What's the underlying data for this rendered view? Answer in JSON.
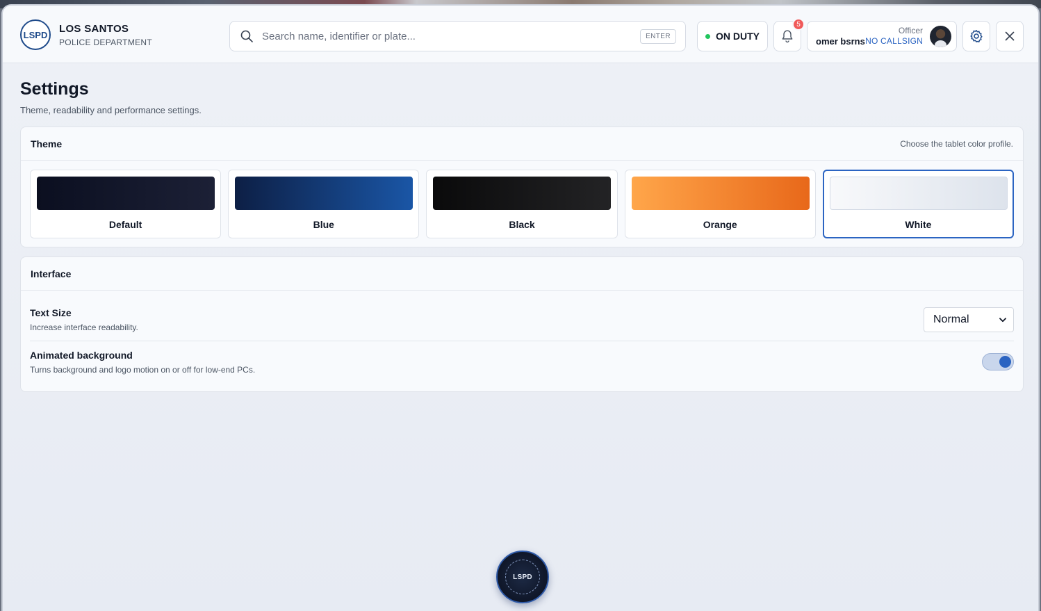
{
  "brand": {
    "logo_text": "LSPD",
    "title": "LOS SANTOS",
    "subtitle": "POLICE DEPARTMENT"
  },
  "search": {
    "placeholder": "Search name, identifier or plate...",
    "value": "",
    "key_hint": "ENTER"
  },
  "status": {
    "label": "ON DUTY",
    "color": "#22c55e"
  },
  "notifications": {
    "count": "5",
    "icon": "bell-icon"
  },
  "officer": {
    "role": "Officer",
    "name": "omer bsrns",
    "callsign": "NO CALLSIGN"
  },
  "toolbar": {
    "settings_icon": "gear-icon",
    "close_icon": "close-icon"
  },
  "page": {
    "title": "Settings",
    "subtitle": "Theme, readability and performance settings."
  },
  "theme_card": {
    "title": "Theme",
    "hint": "Choose the tablet color profile.",
    "options": [
      {
        "label": "Default",
        "gradient_from": "#0b0f20",
        "gradient_to": "#1c2036",
        "selected": false
      },
      {
        "label": "Blue",
        "gradient_from": "#0d1f45",
        "gradient_to": "#1a56a6",
        "selected": false
      },
      {
        "label": "Black",
        "gradient_from": "#0a0a0b",
        "gradient_to": "#232325",
        "selected": false
      },
      {
        "label": "Orange",
        "gradient_from": "#ffa64a",
        "gradient_to": "#e8681a",
        "selected": false
      },
      {
        "label": "White",
        "gradient_from": "#f8f9fb",
        "gradient_to": "#dde3ec",
        "selected": true
      }
    ]
  },
  "interface_card": {
    "title": "Interface",
    "text_size": {
      "title": "Text Size",
      "description": "Increase interface readability.",
      "value": "Normal"
    },
    "animated_background": {
      "title": "Animated background",
      "description": "Turns background and logo motion on or off for low-end PCs.",
      "enabled": true
    }
  },
  "home_button": {
    "label": "LSPD"
  },
  "colors": {
    "accent": "#2b64c2",
    "badge": "#f05a5a"
  }
}
